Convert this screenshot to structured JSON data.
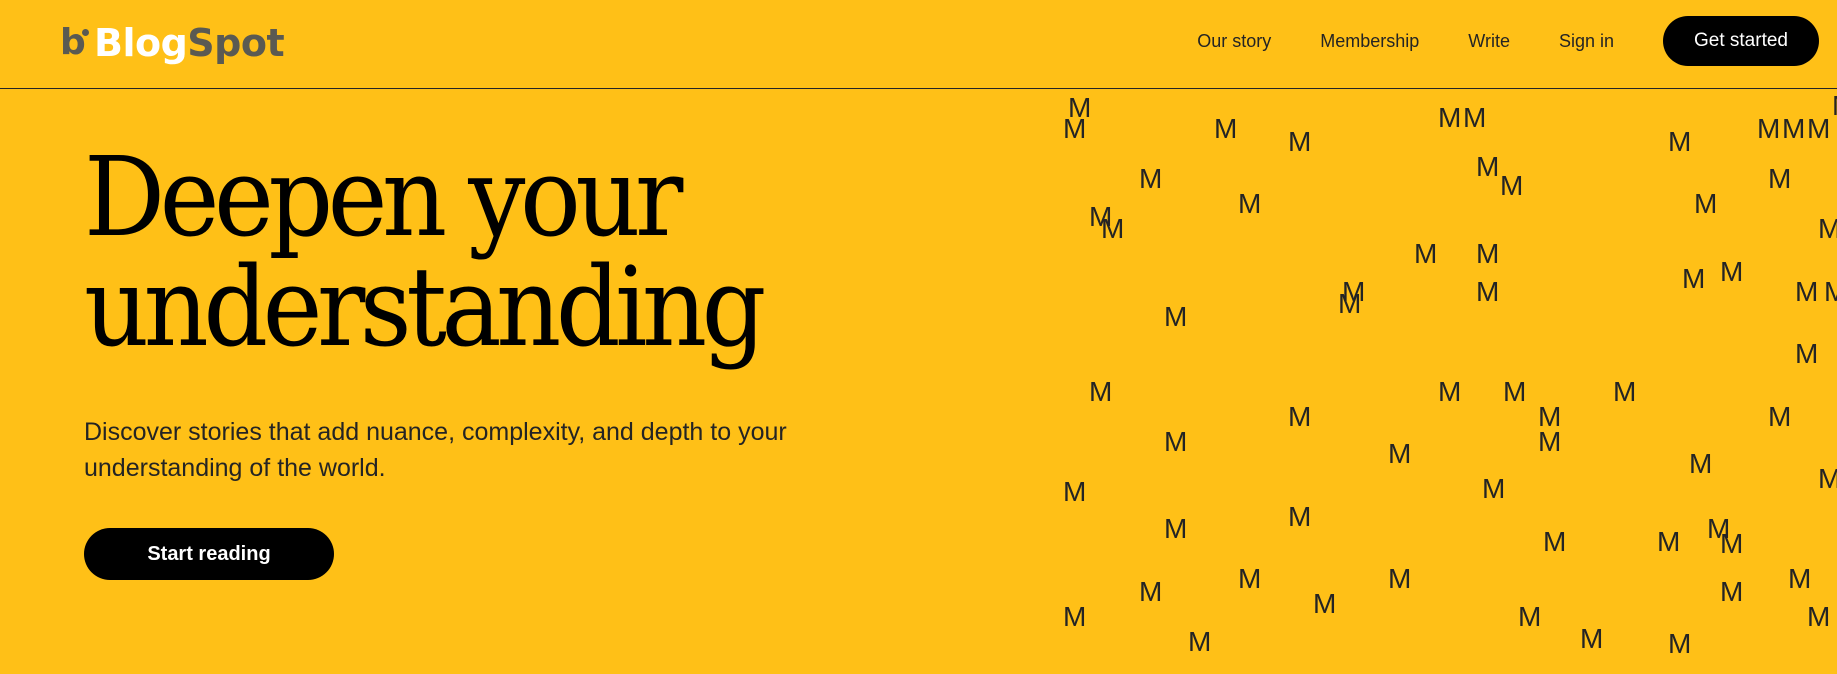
{
  "header": {
    "logo_mark": "b",
    "logo_word_1": "Blog",
    "logo_word_2": "Spot",
    "nav": {
      "our_story": "Our story",
      "membership": "Membership",
      "write": "Write",
      "sign_in": "Sign in",
      "get_started": "Get started"
    }
  },
  "hero": {
    "title_line1": "Deepen your",
    "title_line2": "understanding",
    "subtitle": "Discover stories that add nuance, complexity, and depth to your understanding of the world.",
    "cta": "Start reading"
  },
  "art": {
    "glyph": "M"
  },
  "colors": {
    "background": "#FFC017",
    "button": "#000000",
    "text": "#242424"
  }
}
